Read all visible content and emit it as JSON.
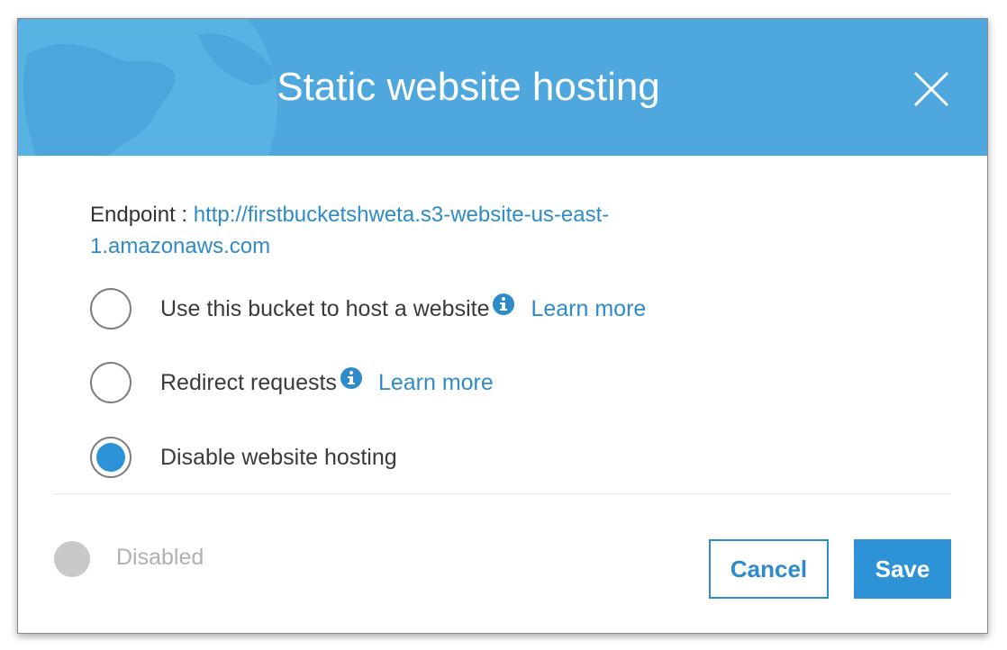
{
  "dialog": {
    "title": "Static website hosting",
    "close_icon": "close-icon",
    "header_color": "#4ea8de"
  },
  "endpoint": {
    "label": "Endpoint : ",
    "url_line1": "http://firstbucketshweta.s3-website-us-east-",
    "url_line2": "1.amazonaws.com"
  },
  "options": [
    {
      "label": "Use this bucket to host a website",
      "learn_more": "Learn more",
      "selected": false,
      "icon": "info-icon"
    },
    {
      "label": "Redirect requests",
      "learn_more": "Learn more",
      "selected": false,
      "icon": "info-icon"
    },
    {
      "label": "Disable website hosting",
      "selected": true
    }
  ],
  "status": {
    "label": "Disabled"
  },
  "buttons": {
    "cancel": "Cancel",
    "save": "Save"
  },
  "colors": {
    "accent": "#2e93d6",
    "link": "#2e8bc9"
  }
}
